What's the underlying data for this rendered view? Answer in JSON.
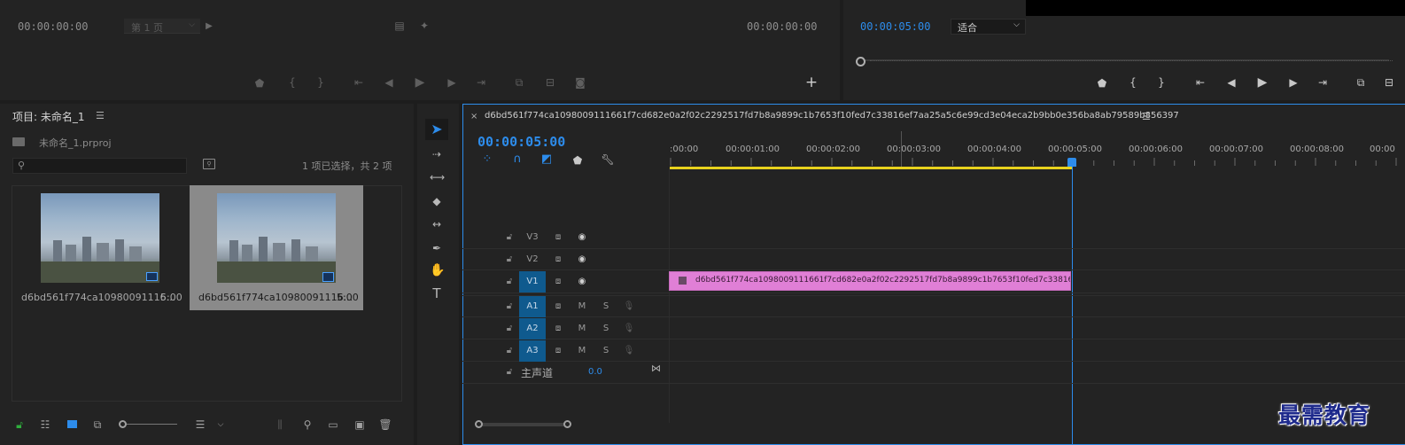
{
  "source_monitor": {
    "timecode_left": "00:00:00:00",
    "page_select": "第 1 页",
    "timecode_right": "00:00:00:00"
  },
  "program_monitor": {
    "timecode": "00:00:05:00",
    "fit_select": "适合"
  },
  "project": {
    "title": "项目: 未命名_1",
    "file_name": "未命名_1.prproj",
    "search_placeholder": "",
    "selection_info": "1 项已选择，共 2 项",
    "items": [
      {
        "name": "d6bd561f774ca10980091116...",
        "duration": "5:00",
        "badge": "clip-badge-icon",
        "selected": false
      },
      {
        "name": "d6bd561f774ca10980091116...",
        "duration": "5:00",
        "badge": "sequence-badge-icon",
        "selected": true
      }
    ]
  },
  "timeline": {
    "sequence_name": "d6bd561f774ca1098009111661f7cd682e0a2f02c2292517fd7b8a9899c1b7653f10fed7c33816ef7aa25a5c6e99cd3e04eca2b9bb0e356ba8ab79589b856397",
    "timecode": "00:00:05:00",
    "ruler_labels": [
      ":00:00",
      "00:00:01:00",
      "00:00:02:00",
      "00:00:03:00",
      "00:00:04:00",
      "00:00:05:00",
      "00:00:06:00",
      "00:00:07:00",
      "00:00:08:00",
      "00:00"
    ],
    "video_tracks": [
      "V3",
      "V2",
      "V1"
    ],
    "audio_tracks": [
      "A1",
      "A2",
      "A3"
    ],
    "audio_buttons": {
      "mute": "M",
      "solo": "S"
    },
    "master_label": "主声道",
    "master_value": "0.0",
    "clip_label": "d6bd561f774ca1098009111661f7cd682e0a2f02c2292517fd7b8a9899c1b7653f10fed7c33816ef7aa25a5c6"
  },
  "watermark": "最需教育",
  "colors": {
    "accent_blue": "#2d8ceb",
    "clip_pink": "#e07fd6",
    "work_area_yellow": "#e8d21d",
    "track_selected": "#0f5a8e"
  }
}
